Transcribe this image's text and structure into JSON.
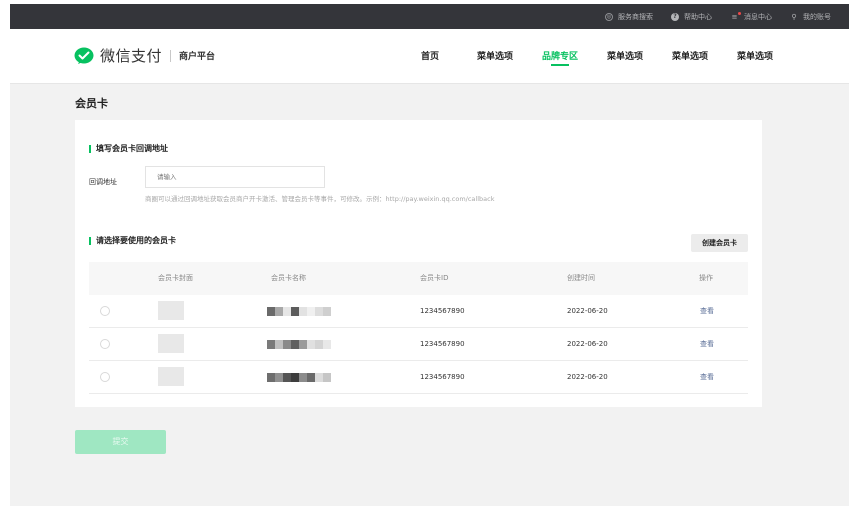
{
  "topbar": {
    "links": [
      {
        "icon": "service-search-icon",
        "label": "服务商搜索"
      },
      {
        "icon": "help-icon",
        "label": "帮助中心"
      },
      {
        "icon": "message-icon",
        "label": "消息中心"
      },
      {
        "icon": "user-icon",
        "label": "我的账号"
      }
    ]
  },
  "header": {
    "brand": "微信支付",
    "sub": "商户平台",
    "nav": [
      "首页",
      "菜单选项",
      "品牌专区",
      "菜单选项",
      "菜单选项",
      "菜单选项"
    ],
    "active_index": 2
  },
  "page": {
    "title": "会员卡"
  },
  "callback": {
    "section_title": "填写会员卡回调地址",
    "label": "回调地址",
    "placeholder": "请输入",
    "hint": "商圈可以通过回调地址获取会员商户开卡激活、管理会员卡等事件，可修改。示例：http://pay.weixin.qq.com/callback"
  },
  "cards": {
    "section_title": "请选择要使用的会员卡",
    "create_label": "创建会员卡",
    "columns": [
      "会员卡封面",
      "会员卡名称",
      "会员卡ID",
      "创建时间",
      "操作"
    ],
    "rows": [
      {
        "id": "1234567890",
        "created": "2022-06-20",
        "action": "查看"
      },
      {
        "id": "1234567890",
        "created": "2022-06-20",
        "action": "查看"
      },
      {
        "id": "1234567890",
        "created": "2022-06-20",
        "action": "查看"
      }
    ]
  },
  "submit_label": "提交",
  "colors": {
    "accent": "#07c160",
    "topbar": "#34353a",
    "link": "#576b95",
    "submit_disabled": "#9fe7c2"
  }
}
